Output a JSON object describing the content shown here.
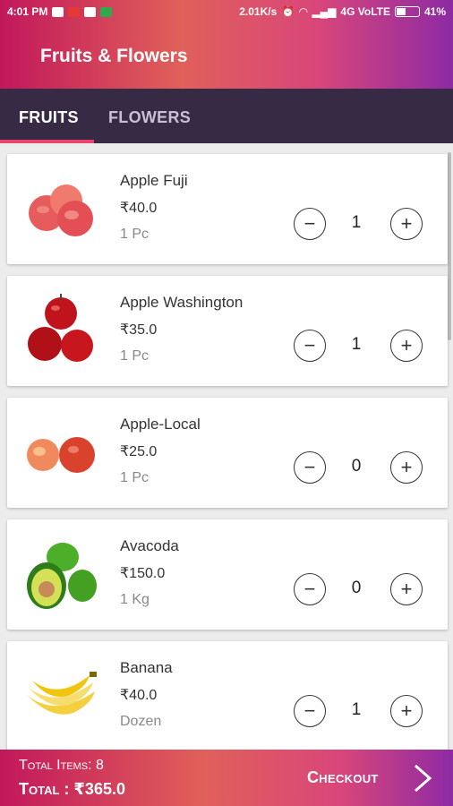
{
  "status_bar": {
    "time": "4:01 PM",
    "speed": "2.01K/s",
    "network": "4G VoLTE",
    "battery": "41%",
    "icons": [
      "phone-icon",
      "gmail-icon",
      "chrome-icon",
      "message-icon",
      "alarm-icon",
      "wifi-icon",
      "signal-icon",
      "battery-icon"
    ]
  },
  "app_bar": {
    "title": "Fruits & Flowers"
  },
  "tabs": [
    {
      "label": "FRUITS",
      "active": true
    },
    {
      "label": "FLOWERS",
      "active": false
    }
  ],
  "products": [
    {
      "name": "Apple Fuji",
      "price": "₹40.0",
      "unit": "1 Pc",
      "qty": "1",
      "image": "apple-fuji-image"
    },
    {
      "name": "Apple Washington",
      "price": "₹35.0",
      "unit": "1 Pc",
      "qty": "1",
      "image": "apple-washington-image"
    },
    {
      "name": "Apple-Local",
      "price": "₹25.0",
      "unit": "1 Pc",
      "qty": "0",
      "image": "apple-local-image"
    },
    {
      "name": "Avacoda",
      "price": "₹150.0",
      "unit": "1 Kg",
      "qty": "0",
      "image": "avocado-image"
    },
    {
      "name": "Banana",
      "price": "₹40.0",
      "unit": "Dozen",
      "qty": "1",
      "image": "banana-image"
    }
  ],
  "controls": {
    "minus": "−",
    "plus": "+"
  },
  "footer": {
    "total_items": "Total Items: 8",
    "total": "Total : ₹365.0",
    "checkout": "Checkout"
  },
  "colors": {
    "accent": "#e8436b",
    "tab_bar": "#372a44",
    "gradient_start": "#c2185b",
    "gradient_end": "#8e2aa4"
  }
}
